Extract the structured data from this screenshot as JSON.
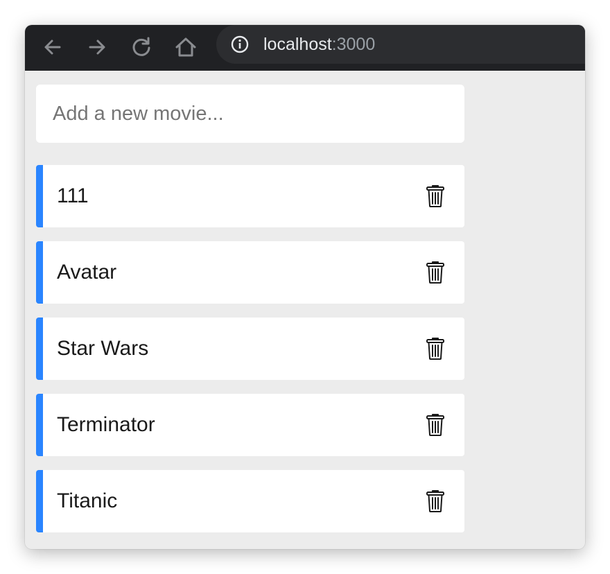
{
  "browser": {
    "url_host": "localhost",
    "url_port": ":3000",
    "nav_icons": [
      "arrow-back-icon",
      "arrow-forward-icon",
      "reload-icon",
      "home-icon",
      "info-icon"
    ]
  },
  "app": {
    "new_movie_input": {
      "value": "",
      "placeholder": "Add a new movie..."
    },
    "movies": [
      {
        "title": "111"
      },
      {
        "title": "Avatar"
      },
      {
        "title": "Star Wars"
      },
      {
        "title": "Terminator"
      },
      {
        "title": "Titanic"
      }
    ],
    "delete_icon": "trash-icon"
  },
  "colors": {
    "accent": "#2a85ff",
    "toolbar_bg": "#202124",
    "page_bg": "#ececec"
  }
}
